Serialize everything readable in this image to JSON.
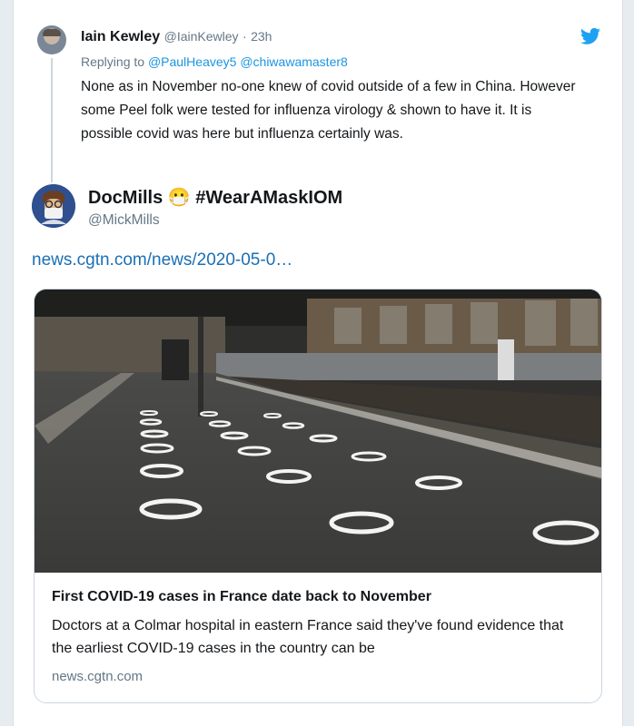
{
  "reply_tweet": {
    "name": "Iain Kewley",
    "handle": "@IainKewley",
    "separator": "·",
    "time": "23h",
    "replying_prefix": "Replying to",
    "mention_1": "@PaulHeavey5",
    "mention_2": "@chiwawamaster8",
    "text": "None as in November no-one knew of covid outside of a few in China. However some Peel folk were tested for influenza virology & shown to have it. It is possible covid was here but influenza certainly was."
  },
  "quoted_tweet": {
    "name": "DocMills",
    "emoji": "😷",
    "hashtag": "#WearAMaskIOM",
    "handle": "@MickMills",
    "link_text": "news.cgtn.com/news/2020-05-0…"
  },
  "link_card": {
    "title": "First COVID-19 cases in France date back to November",
    "description": "Doctors at a Colmar hospital in eastern France said they've found evidence that the earliest COVID-19 cases in the country can be",
    "domain": "news.cgtn.com"
  },
  "colors": {
    "twitter_blue": "#1da1f2",
    "link_blue": "#1b6fb5",
    "mention_blue": "#1b95e0",
    "muted_gray": "#657786"
  },
  "icons": {
    "brand": "twitter-bird-icon"
  }
}
